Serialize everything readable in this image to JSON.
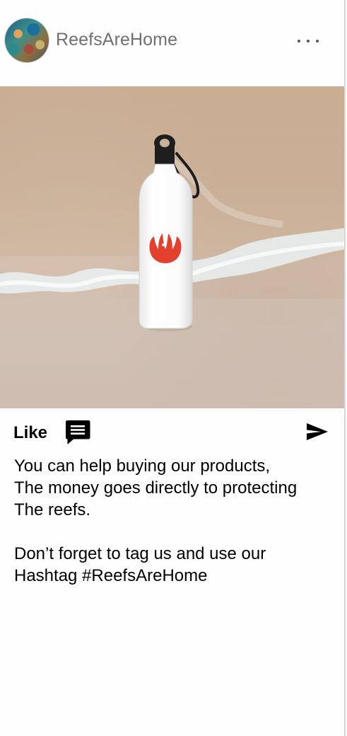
{
  "header": {
    "username": "ReefsAreHome",
    "avatar_icon": "coral-reef-avatar",
    "more_icon": "more-options-icon"
  },
  "photo": {
    "subject": "water-bottle-image",
    "background_color": "#cdb49c"
  },
  "actions": {
    "like_label": "Like",
    "comment_icon": "comment-icon",
    "share_icon": "send-icon"
  },
  "caption": {
    "line1": "You can help buying our products,",
    "line2": "The money goes directly to protecting",
    "line3": "The reefs.",
    "line4": "Don’t forget to tag us and use our",
    "line5": "Hashtag #ReefsAreHome"
  },
  "colors": {
    "username": "#707070",
    "text": "#000000",
    "logo": "#e3402f"
  }
}
